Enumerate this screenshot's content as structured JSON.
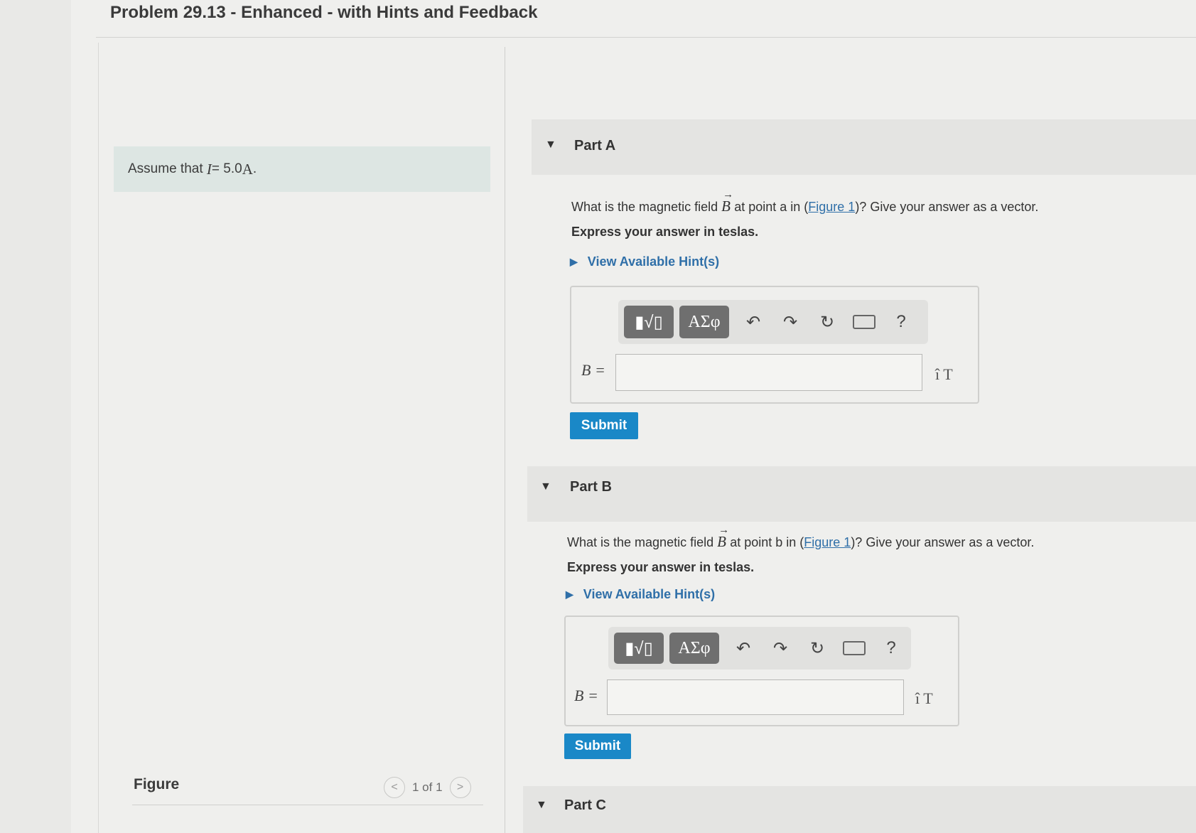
{
  "page": {
    "title": "Problem 29.13 - Enhanced - with Hints and Feedback"
  },
  "left": {
    "assume_prefix": "Assume that",
    "assume_math": "I",
    "assume_value": " = 5.0 ",
    "assume_unit": "A",
    "assume_end": ".",
    "figure_label": "Figure",
    "figure_counter": "1 of 1",
    "prev_glyph": "<",
    "next_glyph": ">"
  },
  "parts": [
    {
      "toggle": "▼",
      "title": "Part A",
      "q_before": "What is the magnetic field",
      "q_symbol": "B",
      "q_mid": "at point a in (",
      "q_link": "Figure 1",
      "q_after": ")? Give your answer as a vector.",
      "express": "Express your answer in teslas.",
      "hint": "View Available Hint(s)",
      "toolbar": {
        "template_icon": "▮√▯",
        "greek": "ΑΣφ",
        "undo_icon": "↶",
        "redo_icon": "↷",
        "reset_icon": "↻",
        "help": "?"
      },
      "eq_label": "B =",
      "input_value": "",
      "unit": "î T",
      "submit": "Submit"
    },
    {
      "toggle": "▼",
      "title": "Part B",
      "q_before": "What is the magnetic field",
      "q_symbol": "B",
      "q_mid": "at point b in (",
      "q_link": "Figure 1",
      "q_after": ")? Give your answer as a vector.",
      "express": "Express your answer in teslas.",
      "hint": "View Available Hint(s)",
      "toolbar": {
        "template_icon": "▮√▯",
        "greek": "ΑΣφ",
        "undo_icon": "↶",
        "redo_icon": "↷",
        "reset_icon": "↻",
        "help": "?"
      },
      "eq_label": "B =",
      "input_value": "",
      "unit": "î T",
      "submit": "Submit"
    },
    {
      "toggle": "▼",
      "title": "Part C"
    }
  ]
}
